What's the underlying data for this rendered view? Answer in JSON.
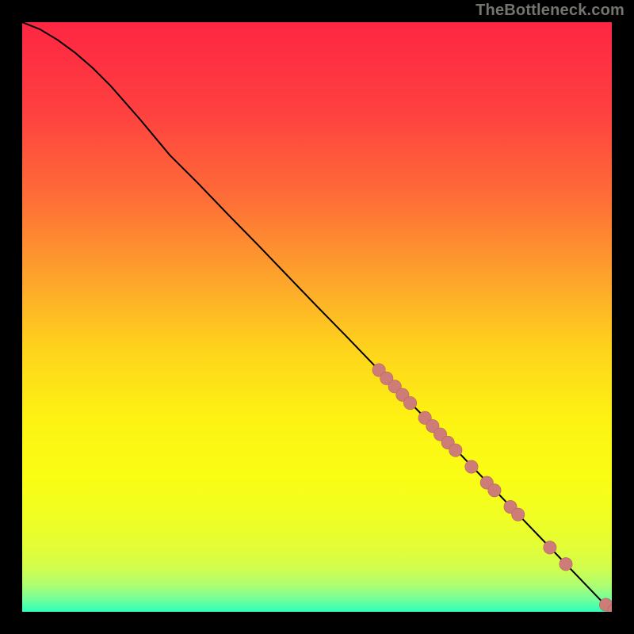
{
  "attribution": "TheBottleneck.com",
  "colors": {
    "curve": "#000000",
    "marker_fill": "#cd7c77",
    "marker_stroke": "#b66560",
    "gradient_stops": [
      {
        "offset": 0.0,
        "color": "#fe2643"
      },
      {
        "offset": 0.15,
        "color": "#fe4040"
      },
      {
        "offset": 0.3,
        "color": "#fe6e37"
      },
      {
        "offset": 0.45,
        "color": "#fdaa2a"
      },
      {
        "offset": 0.55,
        "color": "#fed21c"
      },
      {
        "offset": 0.67,
        "color": "#fdf213"
      },
      {
        "offset": 0.77,
        "color": "#fafd14"
      },
      {
        "offset": 0.84,
        "color": "#f0fe23"
      },
      {
        "offset": 0.89,
        "color": "#e3fd37"
      },
      {
        "offset": 0.925,
        "color": "#d2fd4c"
      },
      {
        "offset": 0.955,
        "color": "#aefe71"
      },
      {
        "offset": 0.978,
        "color": "#75fe99"
      },
      {
        "offset": 1.0,
        "color": "#2ffebc"
      }
    ]
  },
  "chart_data": {
    "type": "line",
    "title": "",
    "xlabel": "",
    "ylabel": "",
    "xlim": [
      0,
      100
    ],
    "ylim": [
      0,
      100
    ],
    "curve": [
      {
        "x": 0,
        "y": 100.0
      },
      {
        "x": 3,
        "y": 98.8
      },
      {
        "x": 6,
        "y": 97.0
      },
      {
        "x": 9,
        "y": 94.8
      },
      {
        "x": 12,
        "y": 92.2
      },
      {
        "x": 15,
        "y": 89.2
      },
      {
        "x": 20,
        "y": 83.5
      },
      {
        "x": 25,
        "y": 77.5
      },
      {
        "x": 30,
        "y": 72.5
      },
      {
        "x": 35,
        "y": 67.3
      },
      {
        "x": 40,
        "y": 62.2
      },
      {
        "x": 45,
        "y": 57.0
      },
      {
        "x": 50,
        "y": 51.8
      },
      {
        "x": 55,
        "y": 46.7
      },
      {
        "x": 60,
        "y": 41.5
      },
      {
        "x": 65,
        "y": 36.3
      },
      {
        "x": 70,
        "y": 31.2
      },
      {
        "x": 75,
        "y": 26.0
      },
      {
        "x": 80,
        "y": 20.8
      },
      {
        "x": 85,
        "y": 15.6
      },
      {
        "x": 90,
        "y": 10.4
      },
      {
        "x": 95,
        "y": 5.2
      },
      {
        "x": 100,
        "y": 0.0
      }
    ],
    "markers": [
      {
        "x": 60.5,
        "y": 41.0,
        "r": 1.1
      },
      {
        "x": 61.8,
        "y": 39.6,
        "r": 1.1
      },
      {
        "x": 63.2,
        "y": 38.2,
        "r": 1.1
      },
      {
        "x": 64.5,
        "y": 36.8,
        "r": 1.1
      },
      {
        "x": 65.8,
        "y": 35.4,
        "r": 1.1
      },
      {
        "x": 68.3,
        "y": 32.9,
        "r": 1.1
      },
      {
        "x": 69.6,
        "y": 31.5,
        "r": 1.1
      },
      {
        "x": 70.9,
        "y": 30.1,
        "r": 1.1
      },
      {
        "x": 72.2,
        "y": 28.7,
        "r": 1.1
      },
      {
        "x": 73.5,
        "y": 27.4,
        "r": 1.1
      },
      {
        "x": 76.2,
        "y": 24.6,
        "r": 1.1
      },
      {
        "x": 78.8,
        "y": 21.9,
        "r": 1.1
      },
      {
        "x": 80.1,
        "y": 20.6,
        "r": 1.1
      },
      {
        "x": 82.8,
        "y": 17.8,
        "r": 1.1
      },
      {
        "x": 84.1,
        "y": 16.5,
        "r": 1.1
      },
      {
        "x": 89.5,
        "y": 10.9,
        "r": 1.1
      },
      {
        "x": 92.2,
        "y": 8.1,
        "r": 1.1
      },
      {
        "x": 99.0,
        "y": 1.2,
        "r": 1.1
      },
      {
        "x": 100.4,
        "y": 0.2,
        "r": 1.1
      }
    ]
  }
}
